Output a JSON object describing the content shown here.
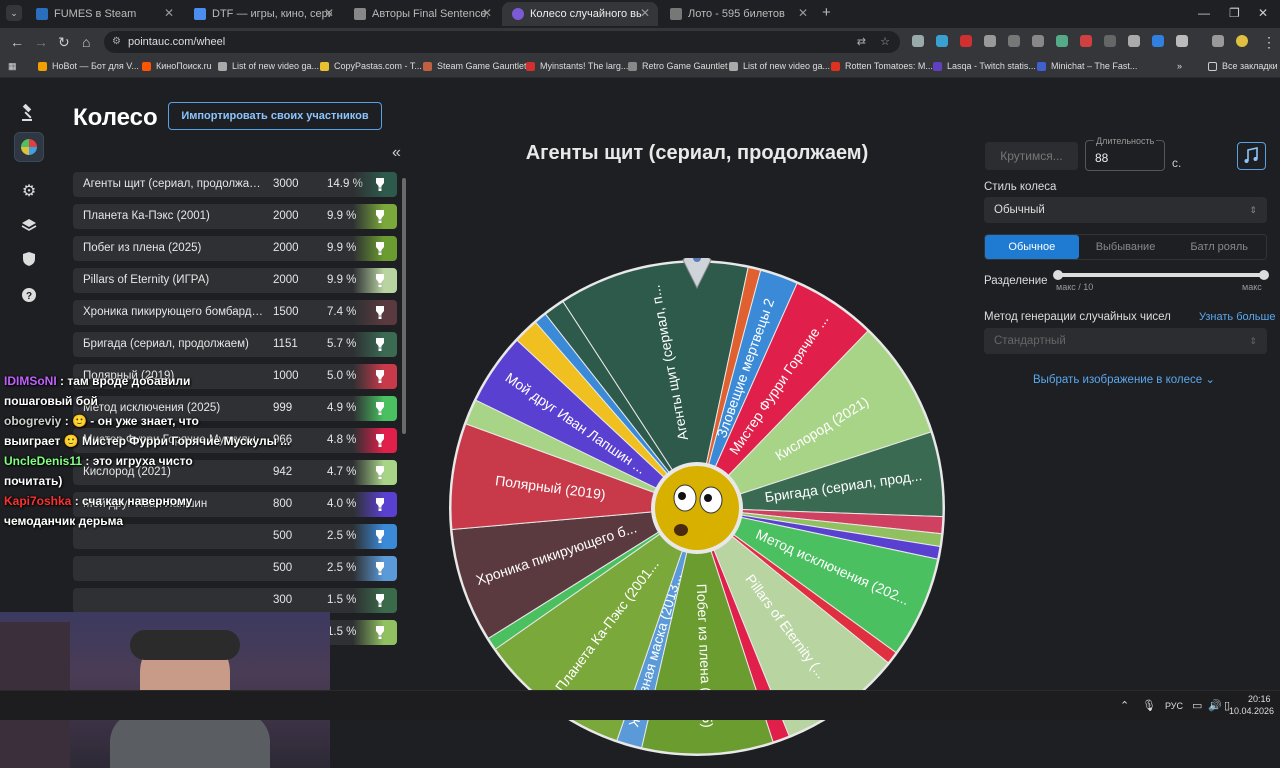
{
  "browser": {
    "tabs": [
      {
        "title": "FUMES в Steam",
        "color": "#2a6fbd",
        "active": false
      },
      {
        "title": "DTF — игры, кино, сериалы, р",
        "color": "#4b8ef0",
        "active": false
      },
      {
        "title": "Авторы Final Sentence, «батл",
        "color": "#888888",
        "active": false
      },
      {
        "title": "Колесо случайного выбора - Р",
        "color": "#7b5ad6",
        "active": true
      },
      {
        "title": "Лото - 595 билетов",
        "color": "#777777",
        "active": false
      }
    ],
    "url": "pointauc.com/wheel",
    "bookmarks": [
      {
        "label": "HoBot — Бот для V...",
        "color": "#f0a000"
      },
      {
        "label": "КиноПоиск.ru",
        "color": "#ff5500"
      },
      {
        "label": "List of new video ga...",
        "color": "#aaaaaa"
      },
      {
        "label": "CopyPastas.com - T...",
        "color": "#e8c030"
      },
      {
        "label": "Steam Game Gauntlet",
        "color": "#c06040"
      },
      {
        "label": "Myinstants! The larg...",
        "color": "#d03030"
      },
      {
        "label": "Retro Game Gauntlet",
        "color": "#888888"
      },
      {
        "label": "List of new video ga...",
        "color": "#aaaaaa"
      },
      {
        "label": "Rotten Tomatoes: M...",
        "color": "#e03020"
      },
      {
        "label": "Lasqa - Twitch statis...",
        "color": "#6040c0"
      },
      {
        "label": "Minichat – The Fast...",
        "color": "#4060d0"
      }
    ],
    "all_bookmarks": "Все закладки"
  },
  "app": {
    "title": "Колесо",
    "import_button": "Импортировать своих участников",
    "collapse_icon": "«",
    "participants": [
      {
        "name": "Агенты щит (сериал, продолжаем)",
        "amount": "3000",
        "percent": "14.9 %",
        "color": "#2d5a4a"
      },
      {
        "name": "Планета Ка-Пэкс (2001)",
        "amount": "2000",
        "percent": "9.9 %",
        "color": "#7aa83a"
      },
      {
        "name": "Побег из плена (2025)",
        "amount": "2000",
        "percent": "9.9 %",
        "color": "#6a9c30"
      },
      {
        "name": "Pillars of Eternity (ИГРА)",
        "amount": "2000",
        "percent": "9.9 %",
        "color": "#b8d4a0"
      },
      {
        "name": "Хроника пикирующего бомбардировщика",
        "amount": "1500",
        "percent": "7.4 %",
        "color": "#5a3a3e"
      },
      {
        "name": "Бригада (сериал, продолжаем)",
        "amount": "1151",
        "percent": "5.7 %",
        "color": "#3a6a52"
      },
      {
        "name": "Полярный (2019)",
        "amount": "1000",
        "percent": "5.0 %",
        "color": "#c83a4a"
      },
      {
        "name": "Метод исключения (2025)",
        "amount": "999",
        "percent": "4.9 %",
        "color": "#4ac060"
      },
      {
        "name": "Мистер Фурри Горячие Мускулы",
        "amount": "966",
        "percent": "4.8 %",
        "color": "#e0204a"
      },
      {
        "name": "Кислород (2021)",
        "amount": "942",
        "percent": "4.7 %",
        "color": "#a8d488"
      },
      {
        "name": "Мой друг Иван Лапшин",
        "amount": "800",
        "percent": "4.0 %",
        "color": "#5a40d0"
      },
      {
        "name": "",
        "amount": "500",
        "percent": "2.5 %",
        "color": "#3a8ad8"
      },
      {
        "name": "",
        "amount": "500",
        "percent": "2.5 %",
        "color": "#5a9ad8"
      },
      {
        "name": "",
        "amount": "300",
        "percent": "1.5 %",
        "color": "#3a6a4a"
      },
      {
        "name": "",
        "amount": "300",
        "percent": "1.5 %",
        "color": "#90c060"
      }
    ],
    "wheel_title": "Агенты щит (сериал, продолжаем)",
    "wheel_labels": [
      "Агенты щит (сериал, п...",
      "Зловещие мертвецы 2",
      "Мистер Фурри Горячие ...",
      "Кислород (2021)",
      "Бригада (сериал, прод...",
      "Метод исключения (202...",
      "Pillars of Eternity (...",
      "Побег из плена (2025)",
      "Железная маска (2013...",
      "Планета Ка-Пэкс (2001...",
      "Хроника пикирующего б...",
      "Полярный (2019)",
      "Мой друг Иван Лапшин ..."
    ],
    "spin_button": "Крутимся...",
    "duration_label": "Длительность",
    "duration_value": "88",
    "duration_unit": "с.",
    "wheel_style_label": "Стиль колеса",
    "wheel_style_value": "Обычный",
    "modes": [
      "Обычное",
      "Выбывание",
      "Батл рояль"
    ],
    "active_mode": "Обычное",
    "split_label": "Разделение",
    "split_min": "макс / 10",
    "split_max": "макс",
    "rng_label": "Метод генерации случайных чисел",
    "rng_more": "Узнать больше",
    "rng_value": "Стандартный",
    "image_link": "Выбрать изображение в колесе"
  },
  "chat": [
    {
      "user": "IDIMSoNI",
      "user_color": "#c060ff",
      "text": ": там вроде добавили"
    },
    {
      "user": "",
      "user_color": "#ffffff",
      "text": "пошаговый бой"
    },
    {
      "user": "obogreviy",
      "user_color": "#ffffff",
      "text": ": 🙂 - он уже знает, что"
    },
    {
      "user": "",
      "user_color": "#ffffff",
      "text": "выиграет 🙂 Мистер Фурри Горячие Мускулы ..."
    },
    {
      "user": "UncleDenis11",
      "user_color": "#80ff80",
      "text": ": это игруха чисто"
    },
    {
      "user": "",
      "user_color": "#ffffff",
      "text": "почитать)"
    },
    {
      "user": "Kapi7oshka",
      "user_color": "#ff3030",
      "text": ": сча как наверному"
    },
    {
      "user": "",
      "user_color": "#ffffff",
      "text": "чемоданчик дерьма"
    }
  ],
  "taskbar": {
    "lang": "РУС",
    "time": "20:16",
    "date": "10.04.2026"
  }
}
